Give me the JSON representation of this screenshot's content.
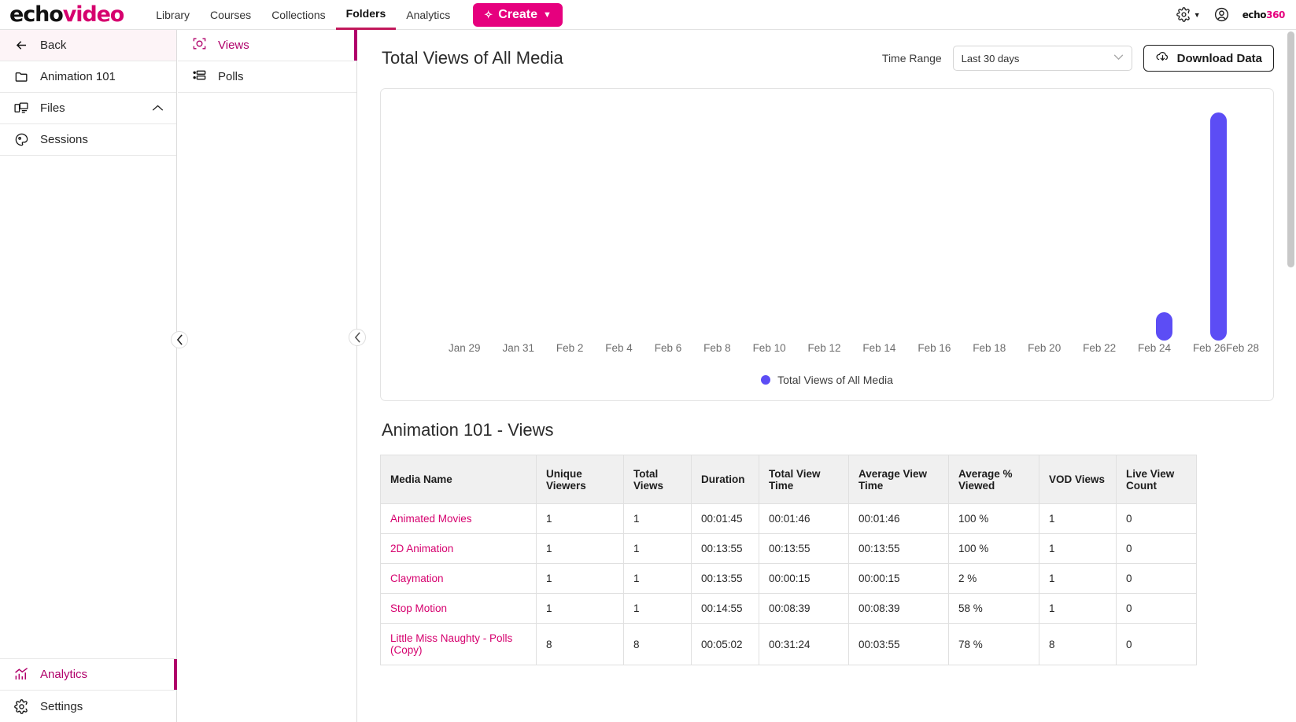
{
  "topnav": {
    "brand_echo": "echo",
    "brand_video": "video",
    "links": [
      {
        "label": "Library",
        "active": false
      },
      {
        "label": "Courses",
        "active": false
      },
      {
        "label": "Collections",
        "active": false
      },
      {
        "label": "Folders",
        "active": true
      },
      {
        "label": "Analytics",
        "active": false
      }
    ],
    "create_label": "Create",
    "create_color": "#e6007e",
    "gear_icon": "gear-icon",
    "account_icon": "account-circle-icon",
    "echo360_a": "echo",
    "echo360_b": "360"
  },
  "sidebar": {
    "items": [
      {
        "label": "Back",
        "icon": "arrow-left-icon"
      },
      {
        "label": "Animation 101",
        "icon": "folder-icon"
      },
      {
        "label": "Files",
        "icon": "files-icon"
      },
      {
        "label": "Sessions",
        "icon": "sessions-icon"
      }
    ],
    "bottom": [
      {
        "label": "Analytics",
        "icon": "analytics-chart-icon",
        "active": true
      },
      {
        "label": "Settings",
        "icon": "gear-icon",
        "active": false
      }
    ],
    "accent": "#b0006a"
  },
  "subpanel": {
    "items": [
      {
        "label": "Views",
        "icon": "views-target-icon",
        "active": true
      },
      {
        "label": "Polls",
        "icon": "polls-list-icon",
        "active": false
      }
    ]
  },
  "chart_header": {
    "title": "Total Views of All Media",
    "time_range_label": "Time Range",
    "time_range_value": "Last 30 days",
    "time_range_options": [
      "Last 30 days"
    ],
    "download_label": "Download Data",
    "download_icon": "cloud-download-icon",
    "chevron_icon": "chevron-down-icon"
  },
  "chart_data": {
    "type": "bar",
    "title": "Total Views of All Media",
    "xlabel": "",
    "ylabel": "",
    "grid": false,
    "legend_position": "bottom",
    "series": [
      {
        "name": "Total Views of All Media",
        "color": "#5c4df5",
        "values": [
          0,
          0,
          0,
          0,
          0,
          0,
          0,
          0,
          0,
          0,
          0,
          0,
          0,
          0,
          0,
          0,
          0,
          0,
          0,
          0,
          0,
          0,
          0,
          0,
          0,
          0,
          1,
          0,
          8,
          0
        ]
      }
    ],
    "categories": [
      "Jan 29",
      "Jan 30",
      "Jan 31",
      "Feb 1",
      "Feb 2",
      "Feb 3",
      "Feb 4",
      "Feb 5",
      "Feb 6",
      "Feb 7",
      "Feb 8",
      "Feb 9",
      "Feb 10",
      "Feb 11",
      "Feb 12",
      "Feb 13",
      "Feb 14",
      "Feb 15",
      "Feb 16",
      "Feb 17",
      "Feb 18",
      "Feb 19",
      "Feb 20",
      "Feb 21",
      "Feb 22",
      "Feb 23",
      "Feb 24",
      "Feb 25",
      "Feb 26",
      "Feb 27"
    ],
    "tick_labels": [
      "Jan 29",
      "",
      "Jan 31",
      "",
      "Feb 2",
      "",
      "Feb 4",
      "",
      "Feb 6",
      "",
      "Feb 8",
      "",
      "Feb 10",
      "",
      "Feb 12",
      "",
      "Feb 14",
      "",
      "Feb 16",
      "",
      "Feb 18",
      "",
      "Feb 20",
      "",
      "Feb 22",
      "",
      "Feb 24",
      "",
      "Feb 26",
      "Feb 28"
    ],
    "ylim": [
      0,
      8
    ],
    "legend_label": "Total Views of All Media"
  },
  "table": {
    "title": "Animation 101 - Views",
    "headers": [
      "Media Name",
      "Unique Viewers",
      "Total Views",
      "Duration",
      "Total View Time",
      "Average View Time",
      "Average % Viewed",
      "VOD Views",
      "Live View Count"
    ],
    "rows": [
      {
        "media_name": "Animated Movies",
        "unique_viewers": "1",
        "total_views": "1",
        "duration": "00:01:45",
        "total_view_time": "00:01:46",
        "average_view_time": "00:01:46",
        "average_pct_viewed": "100 %",
        "vod_views": "1",
        "live_view_count": "0"
      },
      {
        "media_name": "2D Animation",
        "unique_viewers": "1",
        "total_views": "1",
        "duration": "00:13:55",
        "total_view_time": "00:13:55",
        "average_view_time": "00:13:55",
        "average_pct_viewed": "100 %",
        "vod_views": "1",
        "live_view_count": "0"
      },
      {
        "media_name": "Claymation",
        "unique_viewers": "1",
        "total_views": "1",
        "duration": "00:13:55",
        "total_view_time": "00:00:15",
        "average_view_time": "00:00:15",
        "average_pct_viewed": "2 %",
        "vod_views": "1",
        "live_view_count": "0"
      },
      {
        "media_name": "Stop Motion",
        "unique_viewers": "1",
        "total_views": "1",
        "duration": "00:14:55",
        "total_view_time": "00:08:39",
        "average_view_time": "00:08:39",
        "average_pct_viewed": "58 %",
        "vod_views": "1",
        "live_view_count": "0"
      },
      {
        "media_name": "Little Miss Naughty - Polls (Copy)",
        "unique_viewers": "8",
        "total_views": "8",
        "duration": "00:05:02",
        "total_view_time": "00:31:24",
        "average_view_time": "00:03:55",
        "average_pct_viewed": "78 %",
        "vod_views": "8",
        "live_view_count": "0"
      }
    ],
    "link_color": "#d6006e"
  },
  "handles": {
    "collapse_left_icon": "chevron-left-icon",
    "collapse_sub_icon": "chevron-left-icon"
  }
}
